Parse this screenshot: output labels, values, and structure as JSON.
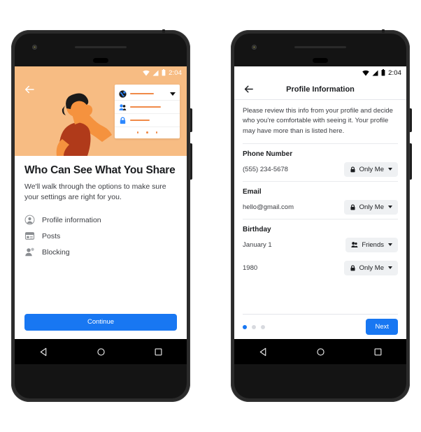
{
  "colors": {
    "brand_blue": "#1877f2",
    "hero_orange": "#f7bc83",
    "illustration_accent": "#f08a48",
    "shirt_red": "#b03a1a",
    "pill_grey": "#eff1f3"
  },
  "phone_left": {
    "status_bar": {
      "clock": "2:04",
      "icons": [
        "wifi-icon",
        "signal-icon",
        "battery-icon"
      ]
    },
    "back_icon": "back-arrow-icon",
    "illustration": {
      "alt_name": "person-thinking-illustration",
      "card_rows": [
        {
          "icon": "globe-icon",
          "has_caret": true
        },
        {
          "icon": "friends-icon",
          "has_caret": false
        },
        {
          "icon": "lock-icon",
          "has_caret": false
        }
      ],
      "card_dot_count": 3
    },
    "headline": "Who Can See What You Share",
    "subtext": "We'll walk through the options to make sure your settings are right for you.",
    "features": [
      {
        "icon": "profile-circle-icon",
        "label": "Profile information"
      },
      {
        "icon": "posts-icon",
        "label": "Posts"
      },
      {
        "icon": "blocking-icon",
        "label": "Blocking"
      }
    ],
    "continue_label": "Continue",
    "nav_buttons": [
      "back-triangle-icon",
      "home-circle-icon",
      "recents-square-icon"
    ]
  },
  "phone_right": {
    "status_bar": {
      "clock": "2:04",
      "icons": [
        "wifi-icon",
        "signal-icon",
        "battery-icon"
      ]
    },
    "back_icon": "back-arrow-icon",
    "title": "Profile Information",
    "intro": "Please review this info from your profile and decide who you're comfortable with seeing it. Your profile may have more than is listed here.",
    "sections": [
      {
        "title": "Phone Number",
        "rows": [
          {
            "value": "(555) 234-5678",
            "audience": "Only Me",
            "audience_icon": "lock-icon"
          }
        ]
      },
      {
        "title": "Email",
        "rows": [
          {
            "value": "hello@gmail.com",
            "audience": "Only Me",
            "audience_icon": "lock-icon"
          }
        ]
      },
      {
        "title": "Birthday",
        "rows": [
          {
            "value": "January 1",
            "audience": "Friends",
            "audience_icon": "friends-icon"
          },
          {
            "value": "1980",
            "audience": "Only Me",
            "audience_icon": "lock-icon"
          }
        ]
      }
    ],
    "pagination": {
      "total": 3,
      "active_index": 0
    },
    "next_label": "Next",
    "nav_buttons": [
      "back-triangle-icon",
      "home-circle-icon",
      "recents-square-icon"
    ]
  }
}
